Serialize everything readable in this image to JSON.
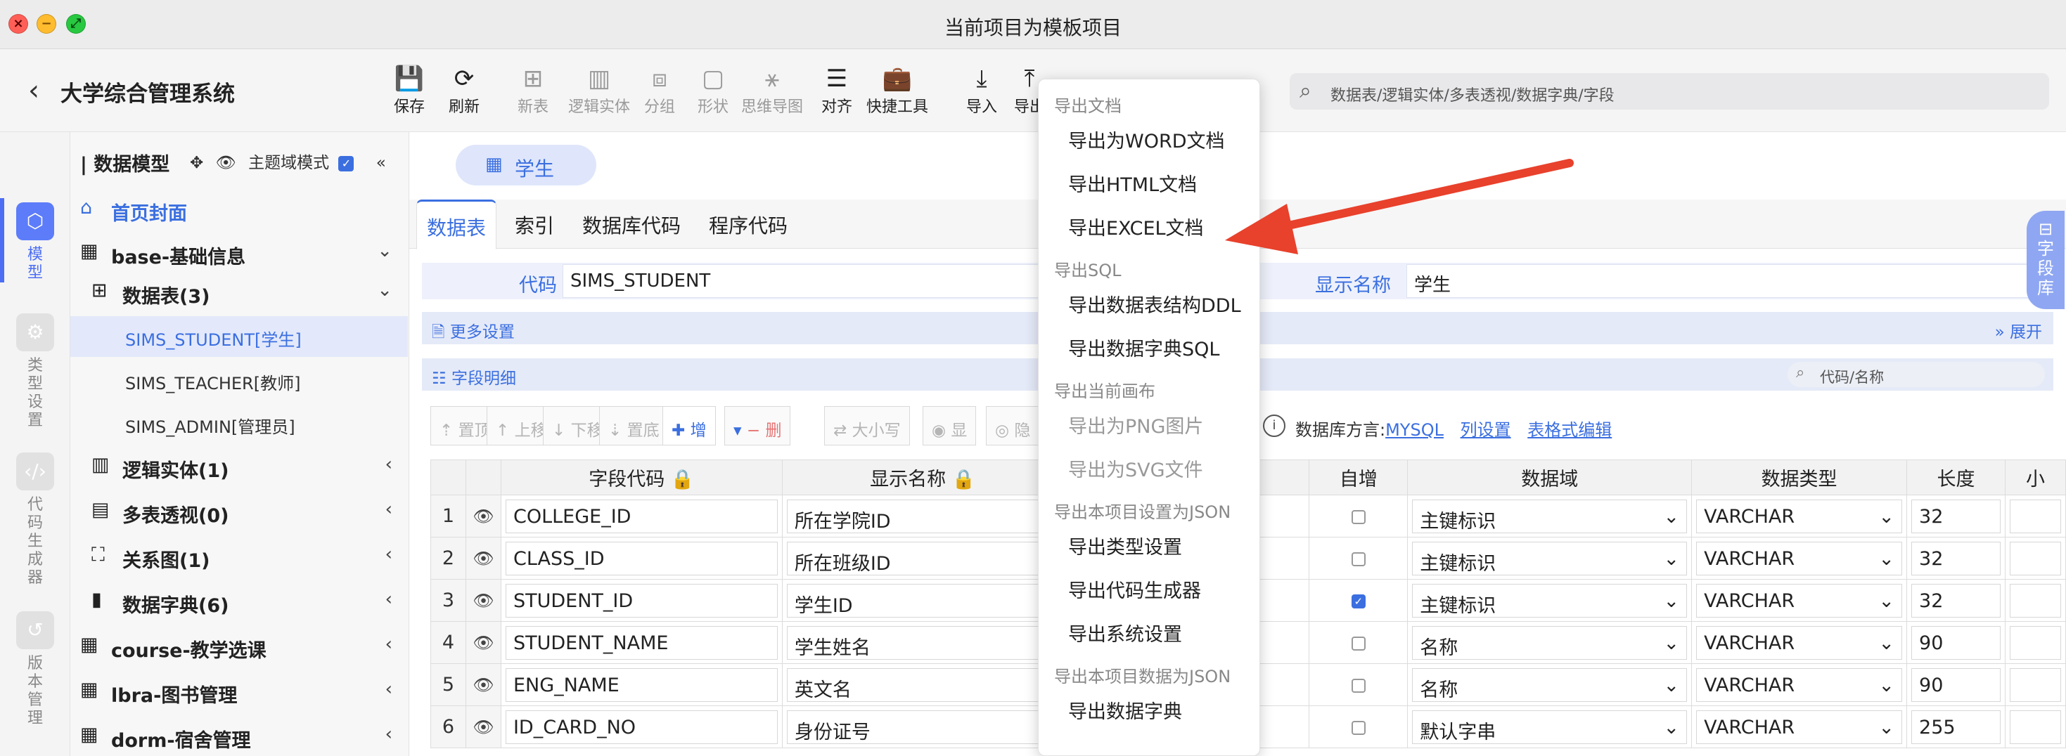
{
  "window": {
    "title": "当前项目为模板项目"
  },
  "toolbar": {
    "app_name": "大学综合管理系统",
    "tools": [
      {
        "id": "save",
        "label": "保存",
        "icon": "💾",
        "enabled": true
      },
      {
        "id": "refresh",
        "label": "刷新",
        "icon": "⟳",
        "enabled": true
      },
      {
        "id": "new-table",
        "label": "新表",
        "icon": "⊞",
        "enabled": false
      },
      {
        "id": "logic-entity",
        "label": "逻辑实体",
        "icon": "▥",
        "enabled": false
      },
      {
        "id": "group",
        "label": "分组",
        "icon": "⧈",
        "enabled": false
      },
      {
        "id": "shape",
        "label": "形状",
        "icon": "▢",
        "enabled": false
      },
      {
        "id": "mindmap",
        "label": "思维导图",
        "icon": "⚹",
        "enabled": false
      },
      {
        "id": "align",
        "label": "对齐",
        "icon": "☰",
        "enabled": true
      },
      {
        "id": "quick-tools",
        "label": "快捷工具",
        "icon": "💼",
        "enabled": true
      },
      {
        "id": "import",
        "label": "导入",
        "icon": "⤓",
        "enabled": true
      },
      {
        "id": "export",
        "label": "导出",
        "icon": "⤒",
        "enabled": true
      }
    ],
    "search_placeholder": "数据表/逻辑实体/多表透视/数据字典/字段"
  },
  "rail": {
    "items": [
      {
        "label": "模型",
        "icon": "cube-icon",
        "active": true
      },
      {
        "label": "类型设置",
        "icon": "settings-icon",
        "active": false
      },
      {
        "label": "代码生成器",
        "icon": "code-icon",
        "active": false
      },
      {
        "label": "版本管理",
        "icon": "history-icon",
        "active": false
      }
    ]
  },
  "sidebar": {
    "title": "| 数据模型",
    "theme_mode_label": "主题域模式",
    "theme_mode_checked": true,
    "home": "首页封面",
    "tree": [
      {
        "label": "base-基础信息",
        "kind": "group",
        "expanded": true
      },
      {
        "label": "数据表(3)",
        "kind": "folder",
        "expanded": true
      },
      {
        "label": "SIMS_STUDENT[学生]",
        "kind": "leaf",
        "selected": true
      },
      {
        "label": "SIMS_TEACHER[教师]",
        "kind": "leaf",
        "selected": false
      },
      {
        "label": "SIMS_ADMIN[管理员]",
        "kind": "leaf",
        "selected": false
      },
      {
        "label": "逻辑实体(1)",
        "kind": "folder",
        "expanded": false
      },
      {
        "label": "多表透视(0)",
        "kind": "folder",
        "expanded": false
      },
      {
        "label": "关系图(1)",
        "kind": "folder",
        "expanded": false
      },
      {
        "label": "数据字典(6)",
        "kind": "folder",
        "expanded": false
      },
      {
        "label": "course-教学选课",
        "kind": "group",
        "expanded": false
      },
      {
        "label": "lbra-图书管理",
        "kind": "group",
        "expanded": false
      },
      {
        "label": "dorm-宿舍管理",
        "kind": "group",
        "expanded": false
      }
    ]
  },
  "main": {
    "entity_tab": "学生",
    "tabs": [
      "数据表",
      "索引",
      "数据库代码",
      "程序代码"
    ],
    "active_tab": 0,
    "code_label": "代码",
    "code_value": "SIMS_STUDENT",
    "display_label": "显示名称",
    "display_value": "学生",
    "more_settings": "更多设置",
    "expand": "展开",
    "field_detail": "字段明细",
    "field_search_placeholder": "代码/名称",
    "grid_buttons": [
      "置顶",
      "上移",
      "下移",
      "置底",
      "增",
      "删",
      "大小写",
      "显",
      "隐"
    ],
    "dialect_label": "数据库方言:",
    "dialect_value": "MYSQL",
    "col_settings": "列设置",
    "table_edit": "表格式编辑",
    "columns": [
      "字段代码",
      "显示名称",
      "自增",
      "数据域",
      "数据类型",
      "长度",
      "小"
    ],
    "rows": [
      {
        "n": "1",
        "code": "COLLEGE_ID",
        "name": "所在学院ID",
        "auto": false,
        "domain": "主键标识",
        "type": "VARCHAR",
        "len": "32"
      },
      {
        "n": "2",
        "code": "CLASS_ID",
        "name": "所在班级ID",
        "auto": false,
        "domain": "主键标识",
        "type": "VARCHAR",
        "len": "32"
      },
      {
        "n": "3",
        "code": "STUDENT_ID",
        "name": "学生ID",
        "auto": true,
        "domain": "主键标识",
        "type": "VARCHAR",
        "len": "32"
      },
      {
        "n": "4",
        "code": "STUDENT_NAME",
        "name": "学生姓名",
        "auto": false,
        "domain": "名称",
        "type": "VARCHAR",
        "len": "90"
      },
      {
        "n": "5",
        "code": "ENG_NAME",
        "name": "英文名",
        "auto": false,
        "domain": "名称",
        "type": "VARCHAR",
        "len": "90"
      },
      {
        "n": "6",
        "code": "ID_CARD_NO",
        "name": "身份证号",
        "auto": false,
        "domain": "默认字串",
        "type": "VARCHAR",
        "len": "255"
      }
    ]
  },
  "menu": {
    "groups": [
      {
        "title": "导出文档",
        "items": [
          {
            "label": "导出为WORD文档",
            "enabled": true
          },
          {
            "label": "导出HTML文档",
            "enabled": true
          },
          {
            "label": "导出EXCEL文档",
            "enabled": true
          }
        ]
      },
      {
        "title": "导出SQL",
        "items": [
          {
            "label": "导出数据表结构DDL",
            "enabled": true
          },
          {
            "label": "导出数据字典SQL",
            "enabled": true
          }
        ]
      },
      {
        "title": "导出当前画布",
        "items": [
          {
            "label": "导出为PNG图片",
            "enabled": false
          },
          {
            "label": "导出为SVG文件",
            "enabled": false
          }
        ]
      },
      {
        "title": "导出本项目设置为JSON",
        "items": [
          {
            "label": "导出类型设置",
            "enabled": true
          },
          {
            "label": "导出代码生成器",
            "enabled": true
          },
          {
            "label": "导出系统设置",
            "enabled": true
          }
        ]
      },
      {
        "title": "导出本项目数据为JSON",
        "items": [
          {
            "label": "导出数据字典",
            "enabled": true
          }
        ]
      }
    ]
  },
  "right_tab": "字段库",
  "colors": {
    "accent": "#3b6fe0",
    "arrow": "#e8412c"
  }
}
